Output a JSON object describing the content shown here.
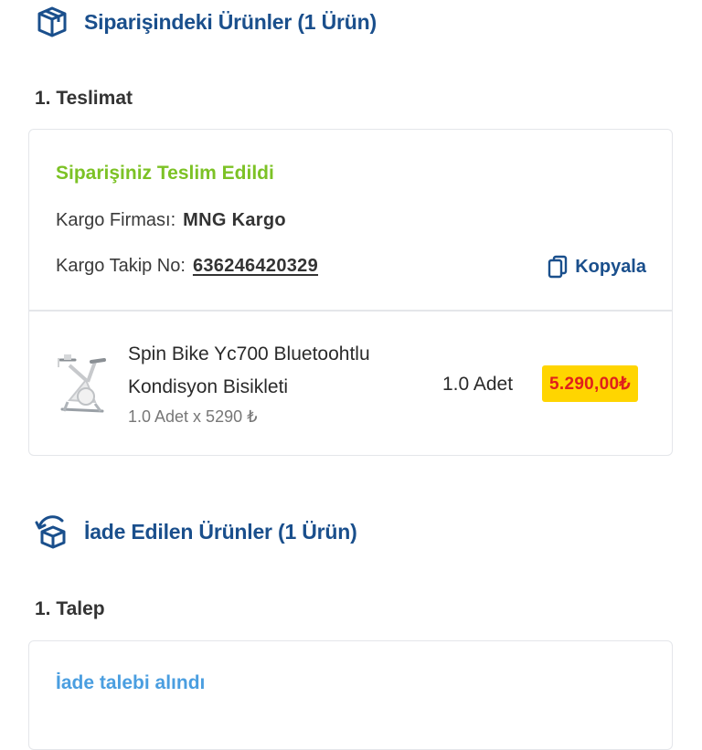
{
  "ordered_section": {
    "title": "Siparişindeki Ürünler (1 Ürün)",
    "icon": "package-icon",
    "step_label": "1. Teslimat",
    "delivery": {
      "status": "Siparişiniz Teslim Edildi",
      "status_color": "#7cc225",
      "carrier_label": "Kargo Firması:",
      "carrier_value": "MNG Kargo",
      "tracking_label": "Kargo Takip No:",
      "tracking_value": "636246420329",
      "copy_label": "Kopyala"
    },
    "product": {
      "name": "Spin Bike Yc700 Bluetoohtlu Kondisyon Bisikleti",
      "unit_detail": "1.0 Adet x 5290 ₺",
      "quantity": "1.0 Adet",
      "price": "5.290,00₺"
    }
  },
  "returned_section": {
    "title": "İade Edilen Ürünler (1 Ürün)",
    "icon": "return-package-icon",
    "step_label": "1. Talep",
    "status": "İade talebi alındı",
    "status_color": "#4a9ee0"
  },
  "colors": {
    "brand_blue": "#1a4f8c",
    "price_bg": "#ffd500",
    "price_text": "#e0201b"
  }
}
